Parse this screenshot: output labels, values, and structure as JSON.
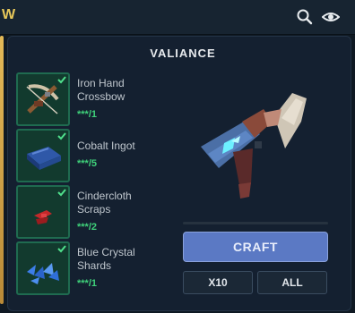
{
  "header": {
    "tab_letter": "W",
    "icons": [
      "search-icon",
      "eye-icon"
    ],
    "accent_color": "#e7c85a"
  },
  "recipe": {
    "title": "VALIANCE",
    "ingredients": [
      {
        "name_line1": "Iron Hand",
        "name_line2": "Crossbow",
        "qty": "***/1",
        "icon": "crossbow-icon",
        "checked": true
      },
      {
        "name_line1": "Cobalt Ingot",
        "name_line2": "",
        "qty": "***/5",
        "icon": "cobalt-ingot-icon",
        "checked": true
      },
      {
        "name_line1": "Cindercloth",
        "name_line2": "Scraps",
        "qty": "***/2",
        "icon": "cindercloth-icon",
        "checked": true
      },
      {
        "name_line1": "Blue Crystal",
        "name_line2": "Shards",
        "qty": "***/1",
        "icon": "crystal-shards-icon",
        "checked": true
      }
    ],
    "preview_icon": "valiance-crossbow-icon"
  },
  "actions": {
    "craft_label": "CRAFT",
    "x10_label": "X10",
    "all_label": "ALL"
  },
  "colors": {
    "qty_ok": "#3fd17a",
    "craft_button": "#5b79c4",
    "slot_bg": "#123a2e"
  }
}
